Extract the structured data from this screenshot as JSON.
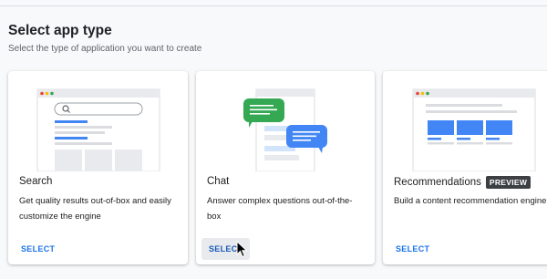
{
  "header": {
    "title": "Select app type",
    "subtitle": "Select the type of application you want to create"
  },
  "cards": [
    {
      "id": "search",
      "title": "Search",
      "description": "Get quality results out-of-box and easily customize the engine",
      "select_label": "SELECT",
      "illustration_icon": "search-icon"
    },
    {
      "id": "chat",
      "title": "Chat",
      "description": "Answer complex questions out-of-the-box",
      "select_label": "SELECT",
      "hovered": true
    },
    {
      "id": "recommendations",
      "title": "Recommendations",
      "badge": "PREVIEW",
      "description": "Build a content recommendation engine",
      "select_label": "SELECT"
    }
  ],
  "colors": {
    "accent": "#1a73e8",
    "chat_bubble_green": "#34a853",
    "chat_bubble_blue": "#4285f4",
    "dot_red": "#ea4335",
    "dot_yellow": "#fbbc04",
    "dot_green": "#34a853"
  }
}
